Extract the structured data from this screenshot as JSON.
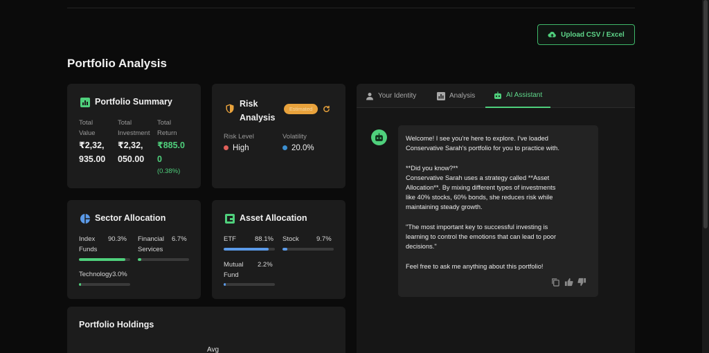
{
  "header": {
    "upload_label": "Upload CSV / Excel",
    "page_title": "Portfolio Analysis"
  },
  "summary": {
    "title": "Portfolio Summary",
    "total_value_label_1": "Total",
    "total_value_label_2": "Value",
    "total_value_1": "₹2,32,",
    "total_value_2": "935.00",
    "total_investment_label_1": "Total",
    "total_investment_label_2": "Investment",
    "total_investment_1": "₹2,32,",
    "total_investment_2": "050.00",
    "total_return_label_1": "Total",
    "total_return_label_2": "Return",
    "total_return_1": "₹885.0",
    "total_return_2": "0",
    "total_return_pct": "(0.38%)"
  },
  "risk": {
    "title_1": "Risk",
    "title_2": "Analysis",
    "badge": "Estimated",
    "risk_level_label": "Risk Level",
    "risk_level": "High",
    "volatility_label": "Volatility",
    "volatility": "20.0%",
    "colors": {
      "high": "#e0605a",
      "volatility": "#3c8fd0"
    }
  },
  "sector": {
    "title": "Sector Allocation",
    "items": [
      {
        "label_1": "Index",
        "label_2": "Funds",
        "pct": "90.3%",
        "fraction": 0.903
      },
      {
        "label_1": "Financial",
        "label_2": "Services",
        "pct": "6.7%",
        "fraction": 0.067
      },
      {
        "label_1": "Technology",
        "label_2": "",
        "pct": "3.0%",
        "fraction": 0.03
      }
    ],
    "bar_color": "#4fd07c"
  },
  "asset": {
    "title": "Asset Allocation",
    "items": [
      {
        "label_1": "ETF",
        "label_2": "",
        "pct": "88.1%",
        "fraction": 0.881
      },
      {
        "label_1": "Stock",
        "label_2": "",
        "pct": "9.7%",
        "fraction": 0.097
      },
      {
        "label_1": "Mutual",
        "label_2": "Fund",
        "pct": "2.2%",
        "fraction": 0.022
      }
    ],
    "bar_color": "#5b9ae8"
  },
  "holdings": {
    "title": "Portfolio Holdings",
    "col_avg": "Avg"
  },
  "tabs": [
    {
      "label": "Your Identity",
      "icon": "person-icon",
      "active": false
    },
    {
      "label": "Analysis",
      "icon": "chart-icon",
      "active": false
    },
    {
      "label": "AI Assistant",
      "icon": "robot-icon",
      "active": true
    }
  ],
  "chat": {
    "lines": [
      "Welcome! I see you're here to explore. I've loaded",
      "Conservative Sarah's portfolio for you to practice with.",
      "",
      "**Did you know?**",
      "Conservative Sarah uses a strategy called **Asset",
      "Allocation**. By mixing different types of investments",
      "like 40% stocks, 60% bonds, she reduces risk while",
      "maintaining steady growth.",
      "",
      "\"The most important key to successful investing is",
      "learning to control the emotions that can lead to poor",
      "decisions.\"",
      "",
      "Feel free to ask me anything about this portfolio!"
    ],
    "actions": [
      "copy-icon",
      "thumbs-up-icon",
      "thumbs-down-icon"
    ]
  },
  "colors": {
    "accent": "#4fd07c",
    "background": "#0b0b0b",
    "card": "#1c1c1c"
  }
}
